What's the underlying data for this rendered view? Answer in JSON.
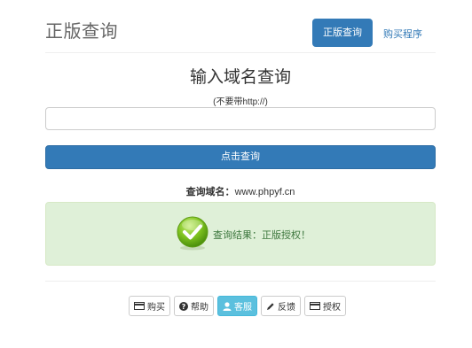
{
  "header": {
    "brand": "正版查询",
    "nav": [
      {
        "label": "正版查询",
        "active": true
      },
      {
        "label": "购买程序",
        "active": false
      }
    ]
  },
  "main": {
    "title": "输入域名查询",
    "hint": "(不要带http://)",
    "input": {
      "value": "",
      "placeholder": ""
    },
    "submit_label": "点击查询"
  },
  "result": {
    "domain_label": "查询域名：",
    "domain_value": "www.phpyf.cn",
    "status_text": "查询结果：正版授权！",
    "status_color": "#3c763d",
    "icon": "check-circle-icon"
  },
  "footer": {
    "buttons": [
      {
        "label": "购买",
        "icon": "card-icon"
      },
      {
        "label": "帮助",
        "icon": "help-icon"
      },
      {
        "label": "客服",
        "icon": "user-icon",
        "active": true
      },
      {
        "label": "反馈",
        "icon": "pencil-icon"
      },
      {
        "label": "授权",
        "icon": "card-icon"
      }
    ]
  },
  "colors": {
    "primary": "#337ab7",
    "success_bg": "#dff0d8",
    "info": "#5bc0de"
  }
}
